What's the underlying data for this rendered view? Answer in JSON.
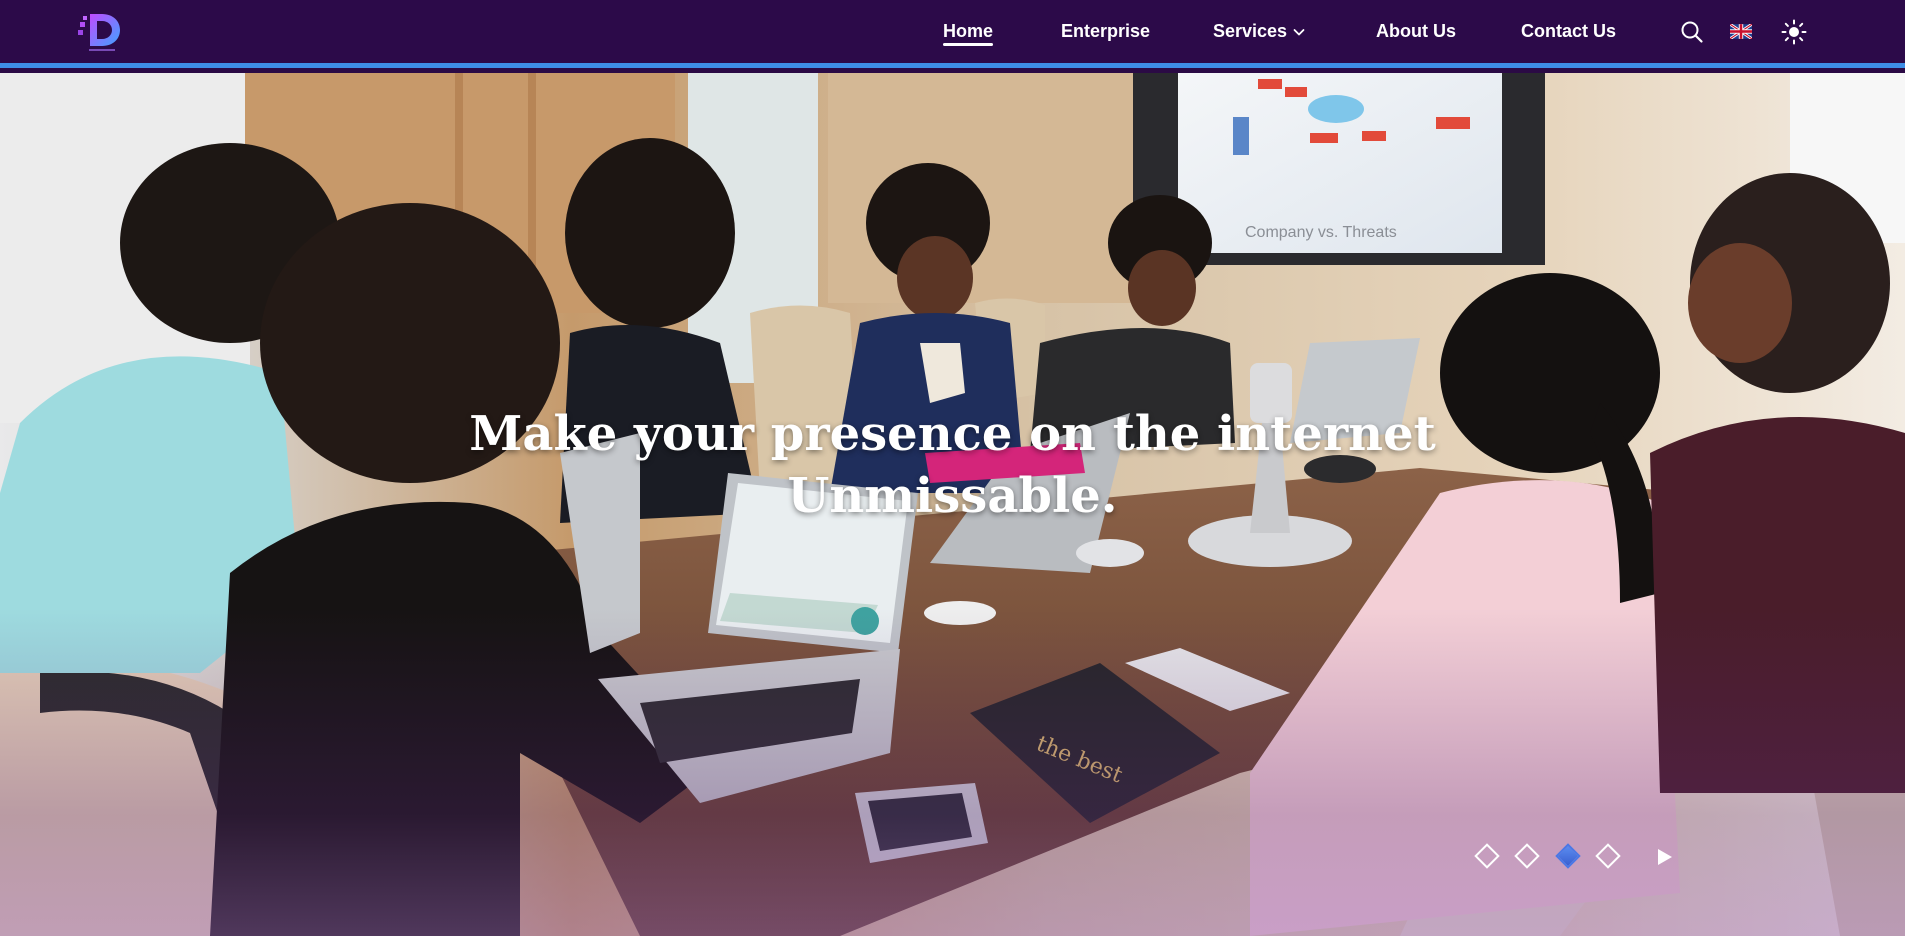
{
  "navbar": {
    "logo_name": "digital-logo",
    "links": [
      {
        "label": "Home",
        "active": true
      },
      {
        "label": "Enterprise",
        "active": false
      },
      {
        "label": "Services",
        "active": false,
        "has_dropdown": true
      },
      {
        "label": "About Us",
        "active": false
      },
      {
        "label": "Contact Us",
        "active": false
      }
    ],
    "tools": [
      "search-icon",
      "uk-flag-icon",
      "theme-toggle-icon"
    ],
    "colors": {
      "background": "#2c0a49",
      "accent_border": "#3e8ee6",
      "text": "#ffffff"
    }
  },
  "hero": {
    "title_line1": "Make your presence on the internet",
    "title_line2": "Unmissable.",
    "carousel": {
      "slides": 4,
      "active_index": 2
    },
    "play_icon": "play-icon"
  }
}
